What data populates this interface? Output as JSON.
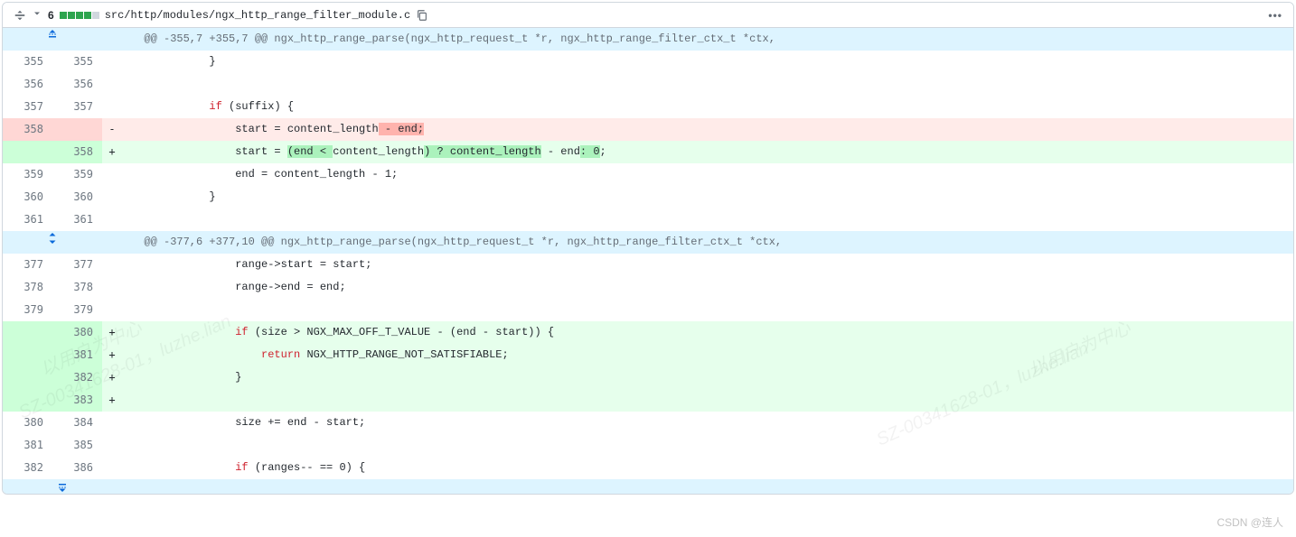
{
  "header": {
    "count": "6",
    "path": "src/http/modules/ngx_http_range_filter_module.c",
    "kebab": "•••"
  },
  "hunks": [
    {
      "type": "hunk",
      "text": "@@ -355,7 +355,7 @@ ngx_http_range_parse(ngx_http_request_t *r, ngx_http_range_filter_ctx_t *ctx,"
    },
    {
      "type": "ctx",
      "old": "355",
      "new": "355",
      "code": "            }"
    },
    {
      "type": "ctx",
      "old": "356",
      "new": "356",
      "code": ""
    },
    {
      "type": "ctx",
      "old": "357",
      "new": "357",
      "code": "            if (suffix) {",
      "kw_if": true
    },
    {
      "type": "del",
      "old": "358",
      "new": "",
      "code_parts": [
        "                start = content_length",
        " - end;"
      ],
      "hl": [
        1
      ]
    },
    {
      "type": "add",
      "old": "",
      "new": "358",
      "code_parts": [
        "                start = ",
        "(end < ",
        "content_length",
        ") ? content_length",
        " - end",
        ": 0",
        ";"
      ],
      "hl": [
        1,
        3,
        5
      ]
    },
    {
      "type": "ctx",
      "old": "359",
      "new": "359",
      "code": "                end = content_length - 1;"
    },
    {
      "type": "ctx",
      "old": "360",
      "new": "360",
      "code": "            }"
    },
    {
      "type": "ctx",
      "old": "361",
      "new": "361",
      "code": ""
    },
    {
      "type": "hunk",
      "expand": true,
      "text": "@@ -377,6 +377,10 @@ ngx_http_range_parse(ngx_http_request_t *r, ngx_http_range_filter_ctx_t *ctx,"
    },
    {
      "type": "ctx",
      "old": "377",
      "new": "377",
      "code": "                range->start = start;"
    },
    {
      "type": "ctx",
      "old": "378",
      "new": "378",
      "code": "                range->end = end;"
    },
    {
      "type": "ctx",
      "old": "379",
      "new": "379",
      "code": ""
    },
    {
      "type": "add",
      "old": "",
      "new": "380",
      "code": "                if (size > NGX_MAX_OFF_T_VALUE - (end - start)) {",
      "kw_if": true
    },
    {
      "type": "add",
      "old": "",
      "new": "381",
      "code": "                    return NGX_HTTP_RANGE_NOT_SATISFIABLE;",
      "kw_return": true
    },
    {
      "type": "add",
      "old": "",
      "new": "382",
      "code": "                }"
    },
    {
      "type": "add",
      "old": "",
      "new": "383",
      "code": ""
    },
    {
      "type": "ctx",
      "old": "380",
      "new": "384",
      "code": "                size += end - start;"
    },
    {
      "type": "ctx",
      "old": "381",
      "new": "385",
      "code": ""
    },
    {
      "type": "ctx",
      "old": "382",
      "new": "386",
      "code": "                if (ranges-- == 0) {",
      "kw_if": true
    }
  ],
  "watermarks": [
    "以用户为中心",
    "SZ-00341628-01，luzhe.lian"
  ],
  "attribution": "CSDN @连人"
}
